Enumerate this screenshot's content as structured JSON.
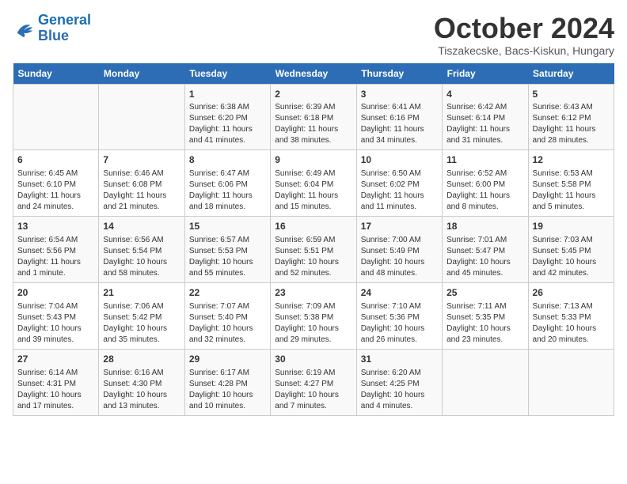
{
  "logo": {
    "line1": "General",
    "line2": "Blue"
  },
  "title": "October 2024",
  "subtitle": "Tiszakecske, Bacs-Kiskun, Hungary",
  "days_of_week": [
    "Sunday",
    "Monday",
    "Tuesday",
    "Wednesday",
    "Thursday",
    "Friday",
    "Saturday"
  ],
  "weeks": [
    [
      {
        "num": "",
        "detail": ""
      },
      {
        "num": "",
        "detail": ""
      },
      {
        "num": "1",
        "detail": "Sunrise: 6:38 AM\nSunset: 6:20 PM\nDaylight: 11 hours and 41 minutes."
      },
      {
        "num": "2",
        "detail": "Sunrise: 6:39 AM\nSunset: 6:18 PM\nDaylight: 11 hours and 38 minutes."
      },
      {
        "num": "3",
        "detail": "Sunrise: 6:41 AM\nSunset: 6:16 PM\nDaylight: 11 hours and 34 minutes."
      },
      {
        "num": "4",
        "detail": "Sunrise: 6:42 AM\nSunset: 6:14 PM\nDaylight: 11 hours and 31 minutes."
      },
      {
        "num": "5",
        "detail": "Sunrise: 6:43 AM\nSunset: 6:12 PM\nDaylight: 11 hours and 28 minutes."
      }
    ],
    [
      {
        "num": "6",
        "detail": "Sunrise: 6:45 AM\nSunset: 6:10 PM\nDaylight: 11 hours and 24 minutes."
      },
      {
        "num": "7",
        "detail": "Sunrise: 6:46 AM\nSunset: 6:08 PM\nDaylight: 11 hours and 21 minutes."
      },
      {
        "num": "8",
        "detail": "Sunrise: 6:47 AM\nSunset: 6:06 PM\nDaylight: 11 hours and 18 minutes."
      },
      {
        "num": "9",
        "detail": "Sunrise: 6:49 AM\nSunset: 6:04 PM\nDaylight: 11 hours and 15 minutes."
      },
      {
        "num": "10",
        "detail": "Sunrise: 6:50 AM\nSunset: 6:02 PM\nDaylight: 11 hours and 11 minutes."
      },
      {
        "num": "11",
        "detail": "Sunrise: 6:52 AM\nSunset: 6:00 PM\nDaylight: 11 hours and 8 minutes."
      },
      {
        "num": "12",
        "detail": "Sunrise: 6:53 AM\nSunset: 5:58 PM\nDaylight: 11 hours and 5 minutes."
      }
    ],
    [
      {
        "num": "13",
        "detail": "Sunrise: 6:54 AM\nSunset: 5:56 PM\nDaylight: 11 hours and 1 minute."
      },
      {
        "num": "14",
        "detail": "Sunrise: 6:56 AM\nSunset: 5:54 PM\nDaylight: 10 hours and 58 minutes."
      },
      {
        "num": "15",
        "detail": "Sunrise: 6:57 AM\nSunset: 5:53 PM\nDaylight: 10 hours and 55 minutes."
      },
      {
        "num": "16",
        "detail": "Sunrise: 6:59 AM\nSunset: 5:51 PM\nDaylight: 10 hours and 52 minutes."
      },
      {
        "num": "17",
        "detail": "Sunrise: 7:00 AM\nSunset: 5:49 PM\nDaylight: 10 hours and 48 minutes."
      },
      {
        "num": "18",
        "detail": "Sunrise: 7:01 AM\nSunset: 5:47 PM\nDaylight: 10 hours and 45 minutes."
      },
      {
        "num": "19",
        "detail": "Sunrise: 7:03 AM\nSunset: 5:45 PM\nDaylight: 10 hours and 42 minutes."
      }
    ],
    [
      {
        "num": "20",
        "detail": "Sunrise: 7:04 AM\nSunset: 5:43 PM\nDaylight: 10 hours and 39 minutes."
      },
      {
        "num": "21",
        "detail": "Sunrise: 7:06 AM\nSunset: 5:42 PM\nDaylight: 10 hours and 35 minutes."
      },
      {
        "num": "22",
        "detail": "Sunrise: 7:07 AM\nSunset: 5:40 PM\nDaylight: 10 hours and 32 minutes."
      },
      {
        "num": "23",
        "detail": "Sunrise: 7:09 AM\nSunset: 5:38 PM\nDaylight: 10 hours and 29 minutes."
      },
      {
        "num": "24",
        "detail": "Sunrise: 7:10 AM\nSunset: 5:36 PM\nDaylight: 10 hours and 26 minutes."
      },
      {
        "num": "25",
        "detail": "Sunrise: 7:11 AM\nSunset: 5:35 PM\nDaylight: 10 hours and 23 minutes."
      },
      {
        "num": "26",
        "detail": "Sunrise: 7:13 AM\nSunset: 5:33 PM\nDaylight: 10 hours and 20 minutes."
      }
    ],
    [
      {
        "num": "27",
        "detail": "Sunrise: 6:14 AM\nSunset: 4:31 PM\nDaylight: 10 hours and 17 minutes."
      },
      {
        "num": "28",
        "detail": "Sunrise: 6:16 AM\nSunset: 4:30 PM\nDaylight: 10 hours and 13 minutes."
      },
      {
        "num": "29",
        "detail": "Sunrise: 6:17 AM\nSunset: 4:28 PM\nDaylight: 10 hours and 10 minutes."
      },
      {
        "num": "30",
        "detail": "Sunrise: 6:19 AM\nSunset: 4:27 PM\nDaylight: 10 hours and 7 minutes."
      },
      {
        "num": "31",
        "detail": "Sunrise: 6:20 AM\nSunset: 4:25 PM\nDaylight: 10 hours and 4 minutes."
      },
      {
        "num": "",
        "detail": ""
      },
      {
        "num": "",
        "detail": ""
      }
    ]
  ]
}
